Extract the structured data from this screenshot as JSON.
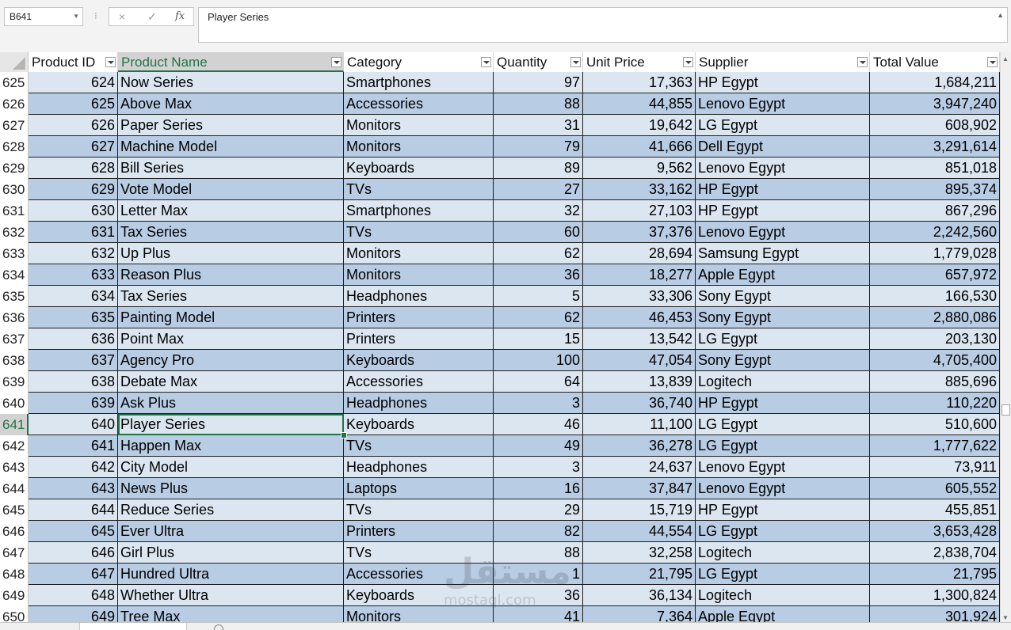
{
  "formula_bar": {
    "name_box": "B641",
    "cancel_icon": "×",
    "enter_icon": "✓",
    "fx_icon": "fx",
    "formula_value": "Player Series"
  },
  "columns": [
    {
      "label": "Product ID"
    },
    {
      "label": "Product Name"
    },
    {
      "label": "Category"
    },
    {
      "label": "Quantity"
    },
    {
      "label": "Unit Price"
    },
    {
      "label": "Supplier"
    },
    {
      "label": "Total Value"
    }
  ],
  "rows": [
    {
      "num": "625",
      "cells": [
        "624",
        "Now Series",
        "Smartphones",
        "97",
        "17,363",
        "HP Egypt",
        "1,684,211"
      ]
    },
    {
      "num": "626",
      "cells": [
        "625",
        "Above Max",
        "Accessories",
        "88",
        "44,855",
        "Lenovo Egypt",
        "3,947,240"
      ]
    },
    {
      "num": "627",
      "cells": [
        "626",
        "Paper Series",
        "Monitors",
        "31",
        "19,642",
        "LG Egypt",
        "608,902"
      ]
    },
    {
      "num": "628",
      "cells": [
        "627",
        "Machine Model",
        "Monitors",
        "79",
        "41,666",
        "Dell Egypt",
        "3,291,614"
      ]
    },
    {
      "num": "629",
      "cells": [
        "628",
        "Bill Series",
        "Keyboards",
        "89",
        "9,562",
        "Lenovo Egypt",
        "851,018"
      ]
    },
    {
      "num": "630",
      "cells": [
        "629",
        "Vote Model",
        "TVs",
        "27",
        "33,162",
        "HP Egypt",
        "895,374"
      ]
    },
    {
      "num": "631",
      "cells": [
        "630",
        "Letter Max",
        "Smartphones",
        "32",
        "27,103",
        "HP Egypt",
        "867,296"
      ]
    },
    {
      "num": "632",
      "cells": [
        "631",
        "Tax Series",
        "TVs",
        "60",
        "37,376",
        "Lenovo Egypt",
        "2,242,560"
      ]
    },
    {
      "num": "633",
      "cells": [
        "632",
        "Up Plus",
        "Monitors",
        "62",
        "28,694",
        "Samsung Egypt",
        "1,779,028"
      ]
    },
    {
      "num": "634",
      "cells": [
        "633",
        "Reason Plus",
        "Monitors",
        "36",
        "18,277",
        "Apple Egypt",
        "657,972"
      ]
    },
    {
      "num": "635",
      "cells": [
        "634",
        "Tax Series",
        "Headphones",
        "5",
        "33,306",
        "Sony Egypt",
        "166,530"
      ]
    },
    {
      "num": "636",
      "cells": [
        "635",
        "Painting Model",
        "Printers",
        "62",
        "46,453",
        "Sony Egypt",
        "2,880,086"
      ]
    },
    {
      "num": "637",
      "cells": [
        "636",
        "Point Max",
        "Printers",
        "15",
        "13,542",
        "LG Egypt",
        "203,130"
      ]
    },
    {
      "num": "638",
      "cells": [
        "637",
        "Agency Pro",
        "Keyboards",
        "100",
        "47,054",
        "Sony Egypt",
        "4,705,400"
      ]
    },
    {
      "num": "639",
      "cells": [
        "638",
        "Debate Max",
        "Accessories",
        "64",
        "13,839",
        "Logitech",
        "885,696"
      ]
    },
    {
      "num": "640",
      "cells": [
        "639",
        "Ask Plus",
        "Headphones",
        "3",
        "36,740",
        "HP Egypt",
        "110,220"
      ]
    },
    {
      "num": "641",
      "cells": [
        "640",
        "Player Series",
        "Keyboards",
        "46",
        "11,100",
        "LG Egypt",
        "510,600"
      ]
    },
    {
      "num": "642",
      "cells": [
        "641",
        "Happen Max",
        "TVs",
        "49",
        "36,278",
        "LG Egypt",
        "1,777,622"
      ]
    },
    {
      "num": "643",
      "cells": [
        "642",
        "City Model",
        "Headphones",
        "3",
        "24,637",
        "Lenovo Egypt",
        "73,911"
      ]
    },
    {
      "num": "644",
      "cells": [
        "643",
        "News Plus",
        "Laptops",
        "16",
        "37,847",
        "Lenovo Egypt",
        "605,552"
      ]
    },
    {
      "num": "645",
      "cells": [
        "644",
        "Reduce Series",
        "TVs",
        "29",
        "15,719",
        "HP Egypt",
        "455,851"
      ]
    },
    {
      "num": "646",
      "cells": [
        "645",
        "Ever Ultra",
        "Printers",
        "82",
        "44,554",
        "LG Egypt",
        "3,653,428"
      ]
    },
    {
      "num": "647",
      "cells": [
        "646",
        "Girl Plus",
        "TVs",
        "88",
        "32,258",
        "Logitech",
        "2,838,704"
      ]
    },
    {
      "num": "648",
      "cells": [
        "647",
        "Hundred Ultra",
        "Accessories",
        "1",
        "21,795",
        "LG Egypt",
        "21,795"
      ]
    },
    {
      "num": "649",
      "cells": [
        "648",
        "Whether Ultra",
        "Keyboards",
        "36",
        "36,134",
        "Logitech",
        "1,300,824"
      ]
    },
    {
      "num": "650",
      "cells": [
        "649",
        "Tree Max",
        "Monitors",
        "41",
        "7,364",
        "Apple Egypt",
        "301,924"
      ]
    }
  ],
  "selection": {
    "row": "641",
    "column": "Product Name"
  },
  "colors": {
    "band_light": "#dce6f1",
    "band_dark": "#b8cce4",
    "excel_green": "#217346"
  },
  "watermark": {
    "logo": "مستقل",
    "site": "mostaql.com"
  }
}
